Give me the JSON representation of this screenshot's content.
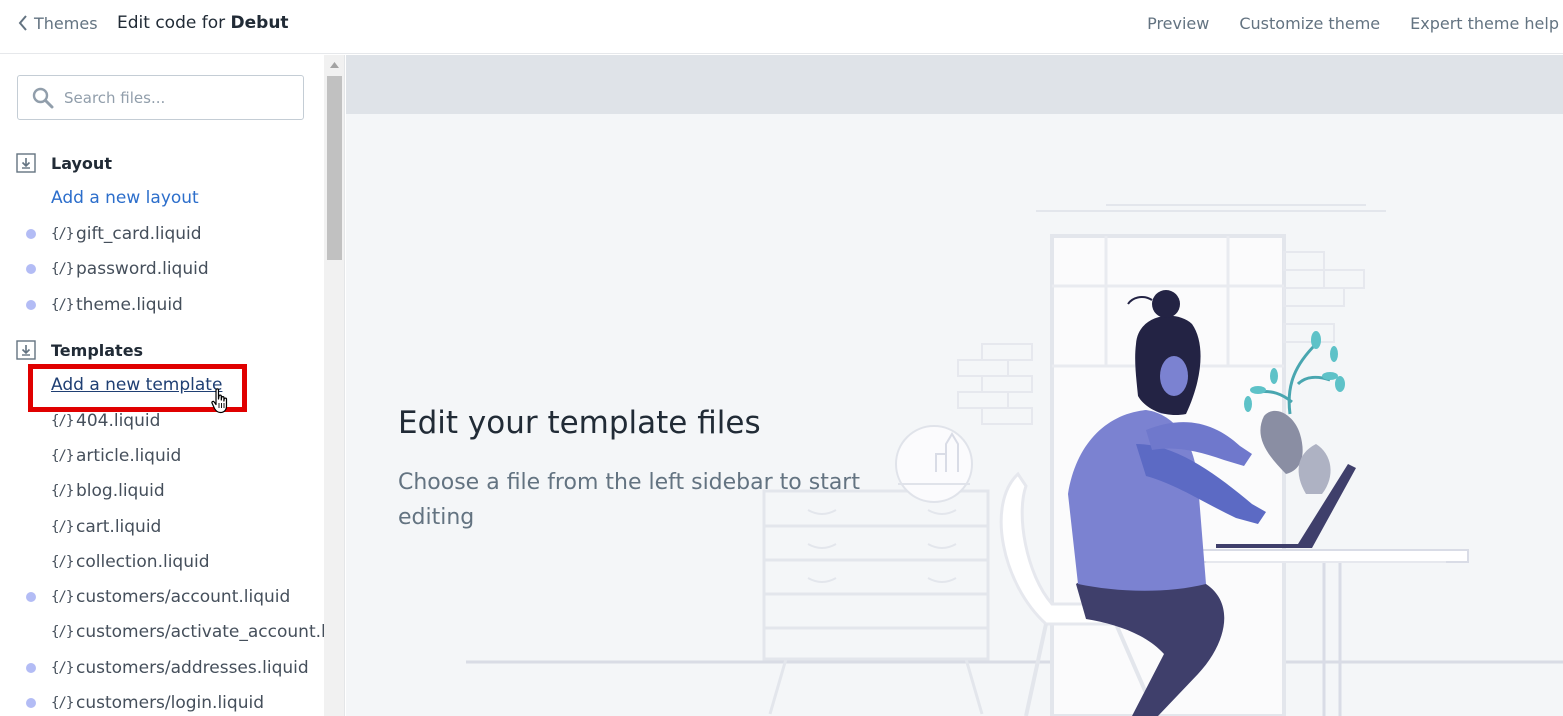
{
  "topbar": {
    "back_label": "Themes",
    "title_prefix": "Edit code for",
    "theme_name": "Debut",
    "links": [
      "Preview",
      "Customize theme",
      "Expert theme help"
    ]
  },
  "search": {
    "placeholder": "Search files..."
  },
  "sections": {
    "layout": {
      "title": "Layout",
      "add_label": "Add a new layout",
      "files": [
        {
          "name": "gift_card.liquid",
          "modified": true
        },
        {
          "name": "password.liquid",
          "modified": true
        },
        {
          "name": "theme.liquid",
          "modified": true
        }
      ]
    },
    "templates": {
      "title": "Templates",
      "add_label": "Add a new template",
      "files": [
        {
          "name": "404.liquid",
          "modified": false
        },
        {
          "name": "article.liquid",
          "modified": false
        },
        {
          "name": "blog.liquid",
          "modified": false
        },
        {
          "name": "cart.liquid",
          "modified": false
        },
        {
          "name": "collection.liquid",
          "modified": false
        },
        {
          "name": "customers/account.liquid",
          "modified": true
        },
        {
          "name": "customers/activate_account.liquid",
          "modified": false
        },
        {
          "name": "customers/addresses.liquid",
          "modified": true
        },
        {
          "name": "customers/login.liquid",
          "modified": true
        }
      ]
    }
  },
  "code_icon": "{/}",
  "main": {
    "title": "Edit your template files",
    "text": "Choose a file from the left sidebar to start editing"
  },
  "colors": {
    "link": "#2c6ecb",
    "modified_dot": "#b3bcf5",
    "highlight": "#e00000",
    "illustration_primary": "#5c6ac4",
    "illustration_dark": "#3f3f6b"
  }
}
